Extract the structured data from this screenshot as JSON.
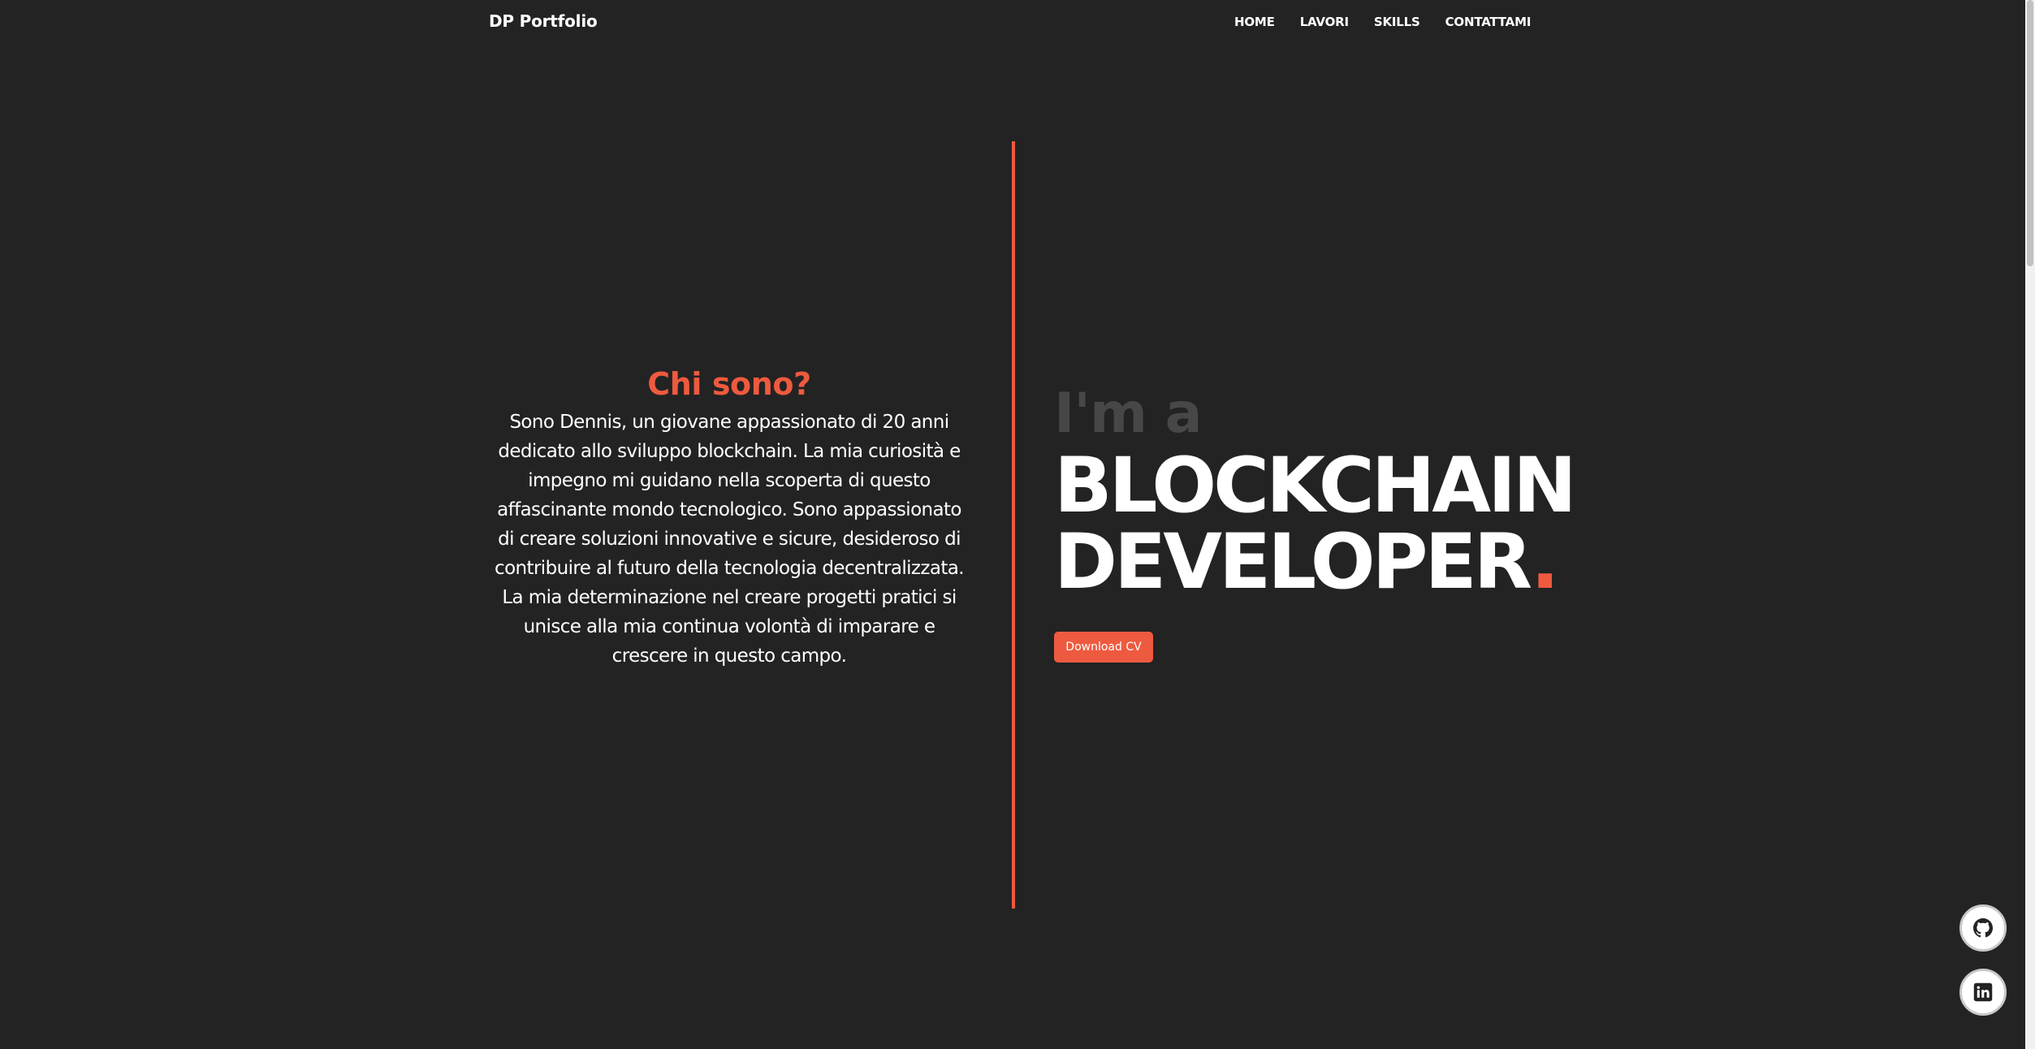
{
  "nav": {
    "brand": "DP Portfolio",
    "links": [
      "HOME",
      "LAVORI",
      "SKILLS",
      "CONTATTAMI"
    ]
  },
  "about": {
    "title": "Chi sono?",
    "text": "Sono Dennis, un giovane appassionato di 20 anni dedicato allo sviluppo blockchain. La mia curiosità e impegno mi guidano nella scoperta di questo affascinante mondo tecnologico. Sono appassionato di creare soluzioni innovative e sicure, desideroso di contribuire al futuro della tecnologia decentralizzata. La mia determinazione nel creare progetti pratici si unisce alla mia continua volontà di imparare e crescere in questo campo."
  },
  "hero": {
    "pre": "I'm a",
    "line1": "BLOCKCHAIN",
    "line2": "DEVELOPER",
    "dot": ".",
    "button": "Download CV"
  },
  "social": {
    "github_icon": "github-icon",
    "linkedin_icon": "linkedin-icon"
  },
  "colors": {
    "background": "#232323",
    "accent": "#ee5a3f",
    "muted": "#474747"
  }
}
